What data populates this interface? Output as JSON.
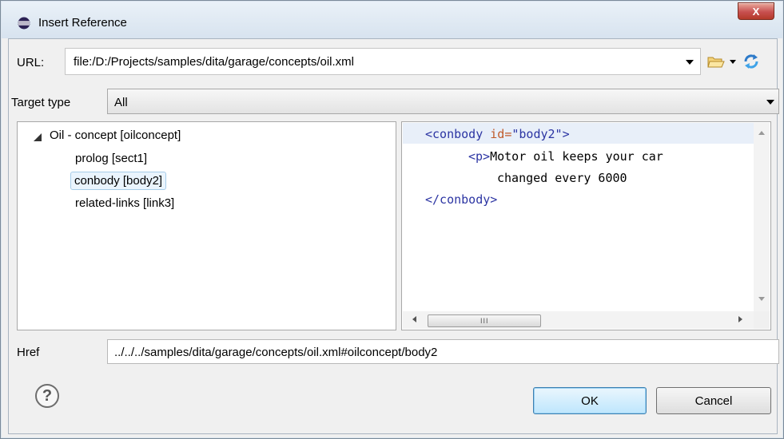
{
  "window": {
    "title": "Insert Reference",
    "close_label": "X"
  },
  "url": {
    "label": "URL:",
    "value": "file:/D:/Projects/samples/dita/garage/concepts/oil.xml"
  },
  "target_type": {
    "label": "Target type",
    "value": "All"
  },
  "tree": {
    "root": "Oil - concept [oilconcept]",
    "children": [
      "prolog [sect1]",
      "conbody [body2]",
      "related-links [link3]"
    ],
    "selected_index": 1
  },
  "preview": {
    "lines": [
      {
        "tag_open": "<conbody",
        "attr": " id=",
        "val": "\"body2\"",
        "tag_close": ">"
      },
      {
        "tag": "<p>",
        "text": "Motor oil keeps your car"
      },
      {
        "text": "changed every 6000"
      },
      {
        "tag": "</conbody>"
      }
    ],
    "hscroll_grip": "III"
  },
  "href": {
    "label": "Href",
    "value": "../../../samples/dita/garage/concepts/oil.xml#oilconcept/body2"
  },
  "buttons": {
    "ok": "OK",
    "cancel": "Cancel",
    "help": "?"
  },
  "colors": {
    "tag": "#2c35a3",
    "attr": "#c05a2a",
    "selection_bg": "#eaf4fd"
  }
}
